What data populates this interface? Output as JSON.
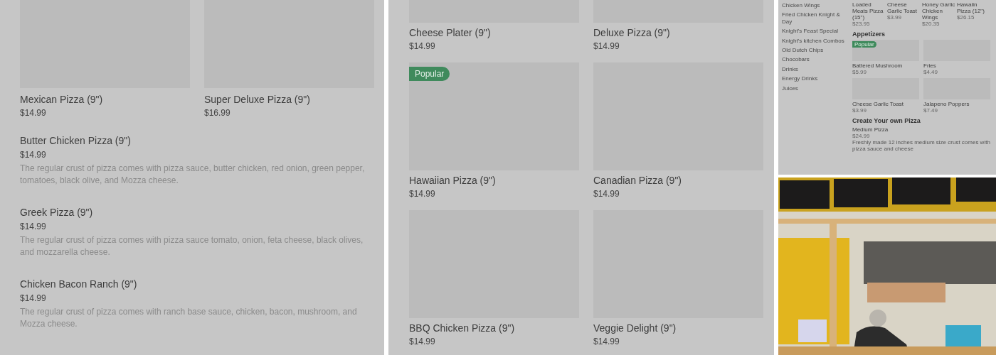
{
  "menu_left": {
    "featured": [
      {
        "name": "Mexican Pizza (9\")",
        "price": "$14.99"
      },
      {
        "name": "Super Deluxe Pizza (9\")",
        "price": "$16.99"
      }
    ],
    "items": [
      {
        "name": "Butter Chicken Pizza (9\")",
        "price": "$14.99",
        "description": "The regular crust of pizza comes with pizza sauce, butter chicken, red onion, green pepper, tomatoes, black olive, and Mozza cheese."
      },
      {
        "name": "Greek Pizza (9\")",
        "price": "$14.99",
        "description": "The regular crust of pizza comes with pizza sauce tomato, onion, feta cheese, black olives, and mozzarella cheese."
      },
      {
        "name": "Chicken Bacon Ranch (9\")",
        "price": "$14.99",
        "description": "The regular crust of pizza comes with ranch base sauce, chicken, bacon, mushroom, and Mozza cheese."
      }
    ]
  },
  "menu_middle": {
    "items": [
      {
        "name": "Cheese Plater (9\")",
        "price": "$14.99",
        "popular": false
      },
      {
        "name": "Deluxe Pizza (9\")",
        "price": "$14.99",
        "popular": false
      },
      {
        "name": "Hawaiian Pizza (9\")",
        "price": "$14.99",
        "popular": true
      },
      {
        "name": "Canadian Pizza (9\")",
        "price": "$14.99",
        "popular": false
      },
      {
        "name": "BBQ Chicken Pizza (9\")",
        "price": "$14.99",
        "popular": false
      },
      {
        "name": "Veggie Delight (9\")",
        "price": "$14.99",
        "popular": false
      }
    ],
    "badge": "Popular"
  },
  "menu_right": {
    "categories": [
      "Chicken Wings",
      "Fried Chicken Knight & Day",
      "Knight's Feast Special",
      "Knight's kitchen Combos",
      "Old Dutch Chips",
      "Chocobars",
      "Drinks",
      "Energy Drinks",
      "Juices"
    ],
    "top_row": [
      {
        "name": "Loaded Meats Pizza (15\")",
        "price": "$23.95"
      },
      {
        "name": "Cheese Garlic Toast",
        "price": "$3.99"
      },
      {
        "name": "Honey Garlic Chicken Wings",
        "price": "$20.35"
      },
      {
        "name": "Hawaiin Pizza (12\")",
        "price": "$26.15"
      }
    ],
    "appetizers": {
      "title": "Appetizers",
      "badge": "Popular",
      "items": [
        {
          "name": "Battered Mushroom",
          "price": "$5.99",
          "popular": true
        },
        {
          "name": "Fries",
          "price": "$4.49",
          "popular": false
        },
        {
          "name": "Cheese Garlic Toast",
          "price": "$3.99",
          "popular": false
        },
        {
          "name": "Jalapeno Poppers",
          "price": "$7.49",
          "popular": false
        }
      ]
    },
    "create_pizza": {
      "title": "Create Your own Pizza",
      "items": [
        {
          "name": "Medium Pizza",
          "price": "$24.99",
          "description": "Freshly made 12 inches medium size crust comes with pizza sauce and cheese"
        }
      ]
    }
  }
}
